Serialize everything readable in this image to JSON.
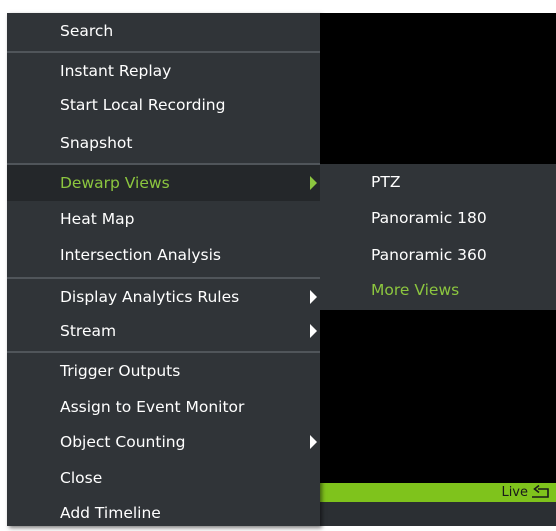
{
  "menu": {
    "search": "Search",
    "instant_replay": "Instant Replay",
    "start_local_recording": "Start Local Recording",
    "snapshot": "Snapshot",
    "dewarp_views": "Dewarp Views",
    "heat_map": "Heat Map",
    "intersection_analysis": "Intersection Analysis",
    "display_analytics_rules": "Display Analytics Rules",
    "stream": "Stream",
    "trigger_outputs": "Trigger Outputs",
    "assign_to_event_monitor": "Assign to Event Monitor",
    "object_counting": "Object Counting",
    "close": "Close",
    "add_timeline": "Add Timeline"
  },
  "submenu": {
    "ptz": "PTZ",
    "panoramic_180": "Panoramic 180",
    "panoramic_360": "Panoramic 360",
    "more_views": "More Views"
  },
  "live": {
    "label": "Live",
    "icon": "replay-arrow-icon"
  },
  "colors": {
    "menu_bg": "#303438",
    "accent_green": "#8cc63f",
    "live_bar": "#7fc31c",
    "text": "#ffffff"
  }
}
